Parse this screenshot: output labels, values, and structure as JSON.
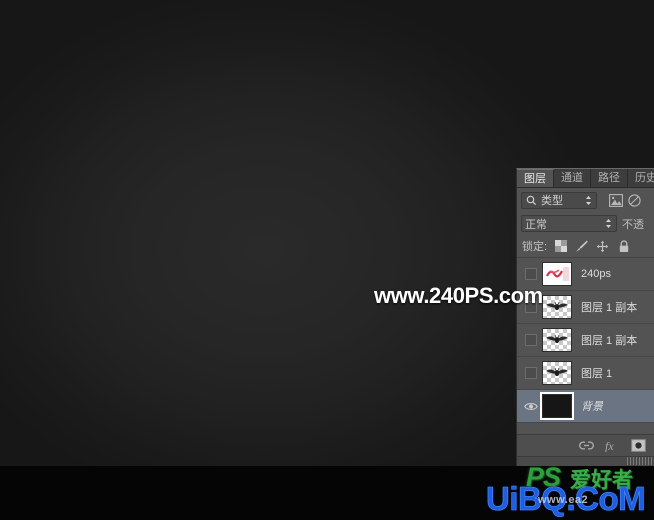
{
  "app": {
    "name": "Adobe Photoshop",
    "canvas_bg": "#262626",
    "panel_bg": "#535353",
    "selection_color": "#6a7482"
  },
  "watermark": {
    "text": "www.240PS.com",
    "color": "#ffffff"
  },
  "site_logo": {
    "ps": "PS",
    "cn": "爱好者",
    "main": "UiBQ.CoM",
    "sub": "www.ea2",
    "ps_color": "#2f9e3f",
    "main_color": "#1d5fe0"
  },
  "panel": {
    "tabs": [
      {
        "label": "图层",
        "active": true
      },
      {
        "label": "通道",
        "active": false
      },
      {
        "label": "路径",
        "active": false
      },
      {
        "label": "历史",
        "active": false
      }
    ],
    "filter": {
      "search_icon": "search-icon",
      "kind_label": "类型",
      "stepper_icon": "updown-arrows-icon",
      "pixel_filter_icon": "image-filter-icon",
      "adjustment_filter_icon": "adjustment-filter-icon"
    },
    "blend": {
      "mode_label": "正常",
      "dropdown_icon": "updown-arrows-icon",
      "opacity_label": "不透"
    },
    "lock": {
      "label": "锁定:",
      "icons": [
        "transparency-lock-icon",
        "brush-lock-icon",
        "position-lock-icon",
        "all-lock-icon"
      ]
    },
    "layers": [
      {
        "name": "240ps",
        "visible": false,
        "selected": false,
        "thumb": "red-text",
        "italic": false
      },
      {
        "name": "图层 1 副本",
        "visible": false,
        "selected": false,
        "thumb": "wing",
        "italic": false
      },
      {
        "name": "图层 1 副本",
        "visible": false,
        "selected": false,
        "thumb": "wing",
        "italic": false
      },
      {
        "name": "图层 1",
        "visible": false,
        "selected": false,
        "thumb": "wing",
        "italic": false
      },
      {
        "name": "背景",
        "visible": true,
        "selected": true,
        "thumb": "solid-dark",
        "italic": true
      }
    ],
    "toolbar": {
      "link_icon": "link-layers-icon",
      "fx_icon": "layer-style-fx-icon",
      "mask_icon": "add-mask-icon"
    },
    "grip": "resize-grip"
  }
}
